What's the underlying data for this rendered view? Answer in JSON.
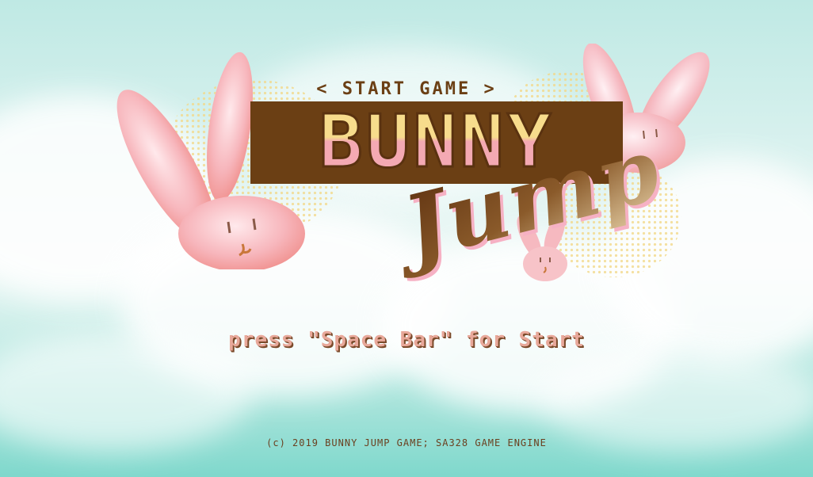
{
  "menu": {
    "start_label": "< START GAME >"
  },
  "logo": {
    "title_top": "BUNNY",
    "title_script": "Jump"
  },
  "prompt": {
    "press_text": "press \"Space Bar\" for Start"
  },
  "footer": {
    "copyright": "(c) 2019 BUNNY JUMP GAME; SA328 GAME ENGINE"
  },
  "colors": {
    "brown": "#6b3f14",
    "pink": "#f4a9b3",
    "yellow": "#f7dc8c",
    "sky": "#bfe9e4"
  },
  "icons": [
    "bunny-left-icon",
    "bunny-right-icon",
    "bunny-small-icon"
  ]
}
